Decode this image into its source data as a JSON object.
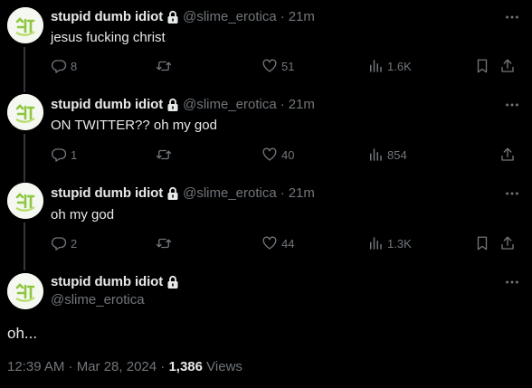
{
  "author": {
    "name": "stupid dumb idiot",
    "handle": "@slime_erotica"
  },
  "separator": "·",
  "thread": [
    {
      "time": "21m",
      "text": "jesus fucking christ",
      "replies": "8",
      "retweets": "",
      "likes": "51",
      "views": "1.6K"
    },
    {
      "time": "21m",
      "text": "ON TWITTER?? oh my god",
      "replies": "1",
      "retweets": "",
      "likes": "40",
      "views": "854"
    },
    {
      "time": "21m",
      "text": "oh my god",
      "replies": "2",
      "retweets": "",
      "likes": "44",
      "views": "1.3K"
    }
  ],
  "main_tweet": {
    "text": "oh...",
    "timestamp": "12:39 AM · Mar 28, 2024",
    "views_count": "1,386",
    "views_label": "Views"
  },
  "colors": {
    "background": "#000000",
    "text": "#e7e9ea",
    "muted": "#71767b",
    "thread_line": "#333639"
  },
  "icons": [
    "lock-icon",
    "more-icon",
    "reply-icon",
    "retweet-icon",
    "like-icon",
    "views-icon",
    "bookmark-icon",
    "share-icon"
  ]
}
